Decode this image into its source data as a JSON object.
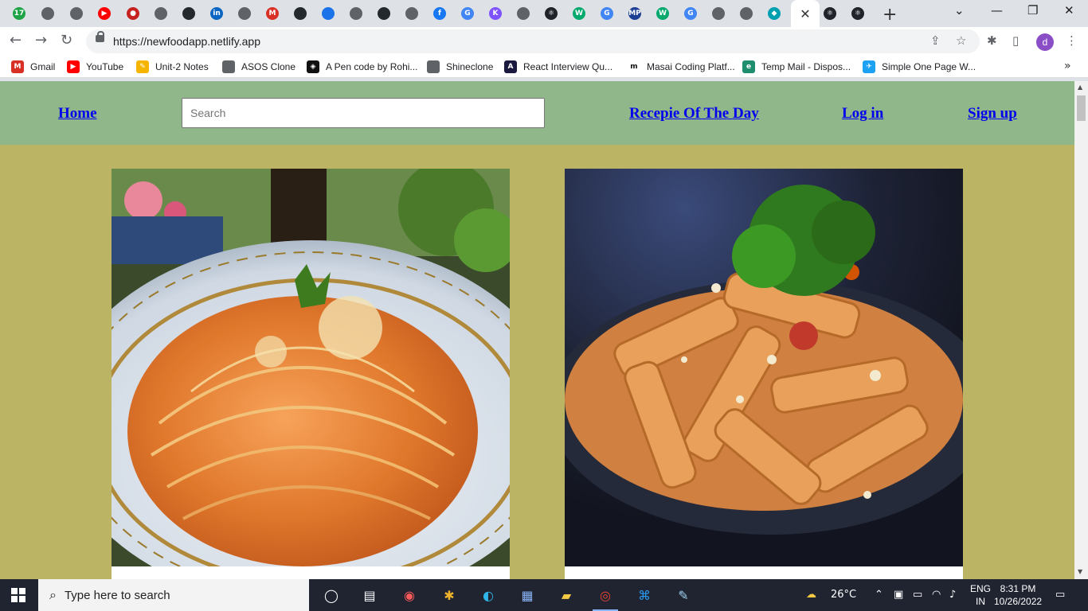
{
  "browser": {
    "tabs": [
      {
        "icon": "badge-17-icon",
        "glyph": "17",
        "color": "#1ea446"
      },
      {
        "icon": "globe-icon",
        "glyph": "",
        "color": "#5f6368"
      },
      {
        "icon": "globe-icon",
        "glyph": "",
        "color": "#5f6368"
      },
      {
        "icon": "youtube-icon",
        "glyph": "▶",
        "color": "#ff0000"
      },
      {
        "icon": "maps-pin-icon",
        "glyph": "●",
        "color": "#c5221f"
      },
      {
        "icon": "globe-icon",
        "glyph": "",
        "color": "#5f6368"
      },
      {
        "icon": "github-icon",
        "glyph": "",
        "color": "#24292e"
      },
      {
        "icon": "linkedin-icon",
        "glyph": "in",
        "color": "#0a66c2"
      },
      {
        "icon": "globe-icon",
        "glyph": "",
        "color": "#5f6368"
      },
      {
        "icon": "gmail-icon",
        "glyph": "M",
        "color": "#d93025"
      },
      {
        "icon": "github-icon",
        "glyph": "",
        "color": "#24292e"
      },
      {
        "icon": "avatar-icon",
        "glyph": "",
        "color": "#1a73e8"
      },
      {
        "icon": "globe-icon",
        "glyph": "",
        "color": "#5f6368"
      },
      {
        "icon": "github-icon",
        "glyph": "",
        "color": "#24292e"
      },
      {
        "icon": "globe-icon",
        "glyph": "",
        "color": "#5f6368"
      },
      {
        "icon": "facebook-icon",
        "glyph": "f",
        "color": "#1877f2"
      },
      {
        "icon": "google-icon",
        "glyph": "G",
        "color": "#4285f4"
      },
      {
        "icon": "kotlin-icon",
        "glyph": "K",
        "color": "#7f52ff"
      },
      {
        "icon": "globe-icon",
        "glyph": "",
        "color": "#5f6368"
      },
      {
        "icon": "react-icon",
        "glyph": "⚛",
        "color": "#20232a"
      },
      {
        "icon": "w3-icon",
        "glyph": "W",
        "color": "#04aa6d"
      },
      {
        "icon": "google-icon",
        "glyph": "G",
        "color": "#4285f4"
      },
      {
        "icon": "mp-icon",
        "glyph": "MP",
        "color": "#1c3f94"
      },
      {
        "icon": "w3-icon",
        "glyph": "W",
        "color": "#04aa6d"
      },
      {
        "icon": "google-icon",
        "glyph": "G",
        "color": "#4285f4"
      },
      {
        "icon": "globe-icon",
        "glyph": "",
        "color": "#5f6368"
      },
      {
        "icon": "globe-icon",
        "glyph": "",
        "color": "#5f6368"
      },
      {
        "icon": "diamond-icon",
        "glyph": "◆",
        "color": "#00a0b0"
      }
    ],
    "after_active_tabs": [
      {
        "icon": "react-icon",
        "glyph": "⚛",
        "color": "#20232a"
      },
      {
        "icon": "react-icon",
        "glyph": "⚛",
        "color": "#20232a"
      }
    ],
    "url": "https://newfoodapp.netlify.app",
    "profile_initial": "d",
    "bookmarks": [
      {
        "label": "Gmail",
        "icon": "gmail-icon",
        "glyph": "M",
        "color": "#d93025"
      },
      {
        "label": "YouTube",
        "icon": "youtube-icon",
        "glyph": "▶",
        "color": "#ff0000"
      },
      {
        "label": "Unit-2 Notes",
        "icon": "pencil-icon",
        "glyph": "✎",
        "color": "#f4b400"
      },
      {
        "label": "ASOS Clone",
        "icon": "globe-icon",
        "glyph": "",
        "color": "#5f6368"
      },
      {
        "label": "A Pen code by Rohi...",
        "icon": "codepen-icon",
        "glyph": "◈",
        "color": "#111111"
      },
      {
        "label": "Shineclone",
        "icon": "globe-icon",
        "glyph": "",
        "color": "#5f6368"
      },
      {
        "label": "React Interview Qu...",
        "icon": "interview-icon",
        "glyph": "A",
        "color": "#1a1a40"
      },
      {
        "label": "Masai Coding Platf...",
        "icon": "masai-icon",
        "glyph": "m",
        "color": "#ffffff"
      },
      {
        "label": "Temp Mail - Dispos...",
        "icon": "tempmail-icon",
        "glyph": "e",
        "color": "#1e8e6e"
      },
      {
        "label": "Simple One Page W...",
        "icon": "bird-icon",
        "glyph": "✈",
        "color": "#1da1f2"
      }
    ]
  },
  "site": {
    "nav": {
      "home": "Home",
      "search_placeholder": "Search",
      "recipe_of_day": "Recepie Of The Day",
      "login": "Log in",
      "signup": "Sign up"
    },
    "cards": [
      {
        "image": "spaghetti-image"
      },
      {
        "image": "penne-image"
      }
    ],
    "colors": {
      "header_bg": "#8fb78a",
      "page_bg": "#bab464",
      "link": "#0000ee"
    }
  },
  "taskbar": {
    "search_text": "Type here to search",
    "weather": "26°C",
    "lang_line1": "ENG",
    "lang_line2": "IN",
    "time": "8:31 PM",
    "date": "10/26/2022"
  }
}
